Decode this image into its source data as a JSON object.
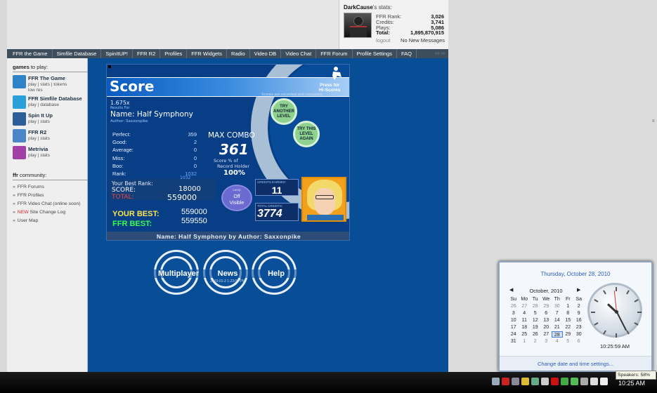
{
  "stats": {
    "user": "DarkCause",
    "suffix": "'s stats:",
    "rank_label": "FFR Rank:",
    "rank": "3,026",
    "credits_label": "Credits:",
    "credits": "3,741",
    "plays_label": "Plays:",
    "plays": "5,086",
    "total_label": "Total:",
    "total": "1,895,870,915",
    "logout": "logout",
    "messages": "No New Messages"
  },
  "nav": [
    "FFR the Game",
    "Simfile Database",
    "SpinItUP!",
    "FFR R2",
    "Profiles",
    "FFR Widgets",
    "Radio",
    "Video DB",
    "Video Chat",
    "FFR Forum",
    "Profile Settings",
    "FAQ"
  ],
  "nav_skin": "## ##",
  "sidebar": {
    "games_title_bold": "games",
    "games_title_rest": " to play:",
    "games": [
      {
        "title": "FFR The Game",
        "links": "play | stats | tokens",
        "extra": "low res",
        "color": "#2f84c9"
      },
      {
        "title": "FFR Simfile Database",
        "links": "play | database",
        "extra": "",
        "color": "#2aa0d8"
      },
      {
        "title": "Spin It Up",
        "links": "play | stats",
        "extra": "",
        "color": "#2c5f9a"
      },
      {
        "title": "FFR R2",
        "links": "play | stats",
        "extra": "",
        "color": "#4a86c8"
      },
      {
        "title": "Metrivia",
        "links": "play | stats",
        "extra": "",
        "color": "#a23fa6"
      }
    ],
    "community_title_bold": "ffr",
    "community_title_rest": " community:",
    "community": [
      {
        "text": "FFR Forums",
        "badge": ""
      },
      {
        "text": "FFR Profiles",
        "badge": ""
      },
      {
        "text": "FFR Video Chat (online soon)",
        "badge": ""
      },
      {
        "text": " Site Change Log",
        "badge": "NEW"
      },
      {
        "text": "User Map",
        "badge": ""
      }
    ]
  },
  "game": {
    "title": "Score",
    "press": "Press for",
    "hiscores": "Hi-Scores",
    "recorded": "Scores are recorded and compared",
    "speed": "1.675x",
    "results_for": "Results For",
    "name_line": "Name: Half Symphony",
    "author_line": "Author: Saxxonpike",
    "try_another": "TRY ANOTHER LEVEL",
    "try_again": "TRY THIS LEVEL AGAIN",
    "stats": [
      {
        "label": "Perfect:",
        "value": "359"
      },
      {
        "label": "Good:",
        "value": "2"
      },
      {
        "label": "Average:",
        "value": "0"
      },
      {
        "label": "Miss:",
        "value": "0"
      },
      {
        "label": "Boo:",
        "value": "0"
      },
      {
        "label": "Rank:",
        "value": "1032"
      }
    ],
    "rank2": "1032",
    "max_combo_label": "MAX COMBO",
    "max_combo": "361",
    "pct_label1": "Score % of",
    "pct_label2": "Record Holder",
    "pct": "100%",
    "best_rank": "Your Best Rank:",
    "score_label": "SCORE:",
    "score": "18000",
    "total_label": "TOTAL:",
    "total": "559000",
    "toggle_top": "Lamp",
    "toggle_off": "Off",
    "toggle_visible": "Visible",
    "credits_earned_label": "CREDITS EARNED:",
    "credits_earned": "11",
    "total_credits_label": "TOTAL CREDITS:",
    "total_credits": "3774",
    "your_best_label": "YOUR BEST:",
    "your_best": "559000",
    "ffr_best_label": "FFR BEST:",
    "ffr_best": "559550",
    "footer": "Name: Half Symphony by Author: Saxxonpike"
  },
  "buttons": {
    "multiplayer": "Multiplayer",
    "news": "News",
    "news_date": "2010-01-2 1:23:09 PM",
    "help": "Help"
  },
  "calendar": {
    "full_date": "Thursday, October 28, 2010",
    "month": "October, 2010",
    "days_header": [
      "Su",
      "Mo",
      "Tu",
      "We",
      "Th",
      "Fr",
      "Sa"
    ],
    "days": [
      {
        "d": "26",
        "o": true
      },
      {
        "d": "27",
        "o": true
      },
      {
        "d": "28",
        "o": true
      },
      {
        "d": "29",
        "o": true
      },
      {
        "d": "30",
        "o": true
      },
      {
        "d": "1",
        "o": false
      },
      {
        "d": "2",
        "o": false
      },
      {
        "d": "3",
        "o": false
      },
      {
        "d": "4",
        "o": false
      },
      {
        "d": "5",
        "o": false
      },
      {
        "d": "6",
        "o": false
      },
      {
        "d": "7",
        "o": false
      },
      {
        "d": "8",
        "o": false
      },
      {
        "d": "9",
        "o": false
      },
      {
        "d": "10",
        "o": false
      },
      {
        "d": "11",
        "o": false
      },
      {
        "d": "12",
        "o": false
      },
      {
        "d": "13",
        "o": false
      },
      {
        "d": "14",
        "o": false
      },
      {
        "d": "15",
        "o": false
      },
      {
        "d": "16",
        "o": false
      },
      {
        "d": "17",
        "o": false
      },
      {
        "d": "18",
        "o": false
      },
      {
        "d": "19",
        "o": false
      },
      {
        "d": "20",
        "o": false
      },
      {
        "d": "21",
        "o": false
      },
      {
        "d": "22",
        "o": false
      },
      {
        "d": "23",
        "o": false
      },
      {
        "d": "24",
        "o": false
      },
      {
        "d": "25",
        "o": false
      },
      {
        "d": "26",
        "o": false
      },
      {
        "d": "27",
        "o": false
      },
      {
        "d": "28",
        "o": false,
        "today": true
      },
      {
        "d": "29",
        "o": false
      },
      {
        "d": "30",
        "o": false
      },
      {
        "d": "31",
        "o": false
      },
      {
        "d": "1",
        "o": true
      },
      {
        "d": "2",
        "o": true
      },
      {
        "d": "3",
        "o": true
      },
      {
        "d": "4",
        "o": true
      },
      {
        "d": "5",
        "o": true
      },
      {
        "d": "6",
        "o": true
      }
    ],
    "time": "10:25:59 AM",
    "settings_link": "Change date and time settings..."
  },
  "taskbar": {
    "clock": "10:25 AM",
    "speakers_tooltip": "Speakers: 58%",
    "tray_icons": [
      {
        "name": "shield-icon",
        "color": "#9ab"
      },
      {
        "name": "red-app-icon",
        "color": "#c22"
      },
      {
        "name": "tool-icon",
        "color": "#889"
      },
      {
        "name": "yellow-app-icon",
        "color": "#db3"
      },
      {
        "name": "network-tool-icon",
        "color": "#6a8"
      },
      {
        "name": "flag-icon",
        "color": "#ccc"
      },
      {
        "name": "ati-icon",
        "color": "#c11"
      },
      {
        "name": "update-icon",
        "color": "#4a4"
      },
      {
        "name": "sync-icon",
        "color": "#5b5"
      },
      {
        "name": "arrow-icon",
        "color": "#aaa"
      },
      {
        "name": "signal-icon",
        "color": "#ddd"
      },
      {
        "name": "speaker-icon",
        "color": "#eee"
      }
    ]
  },
  "colors": {
    "page_bg": "#074e97",
    "nav_bg": "#3d4d5c",
    "accent": "#2c60b8"
  }
}
